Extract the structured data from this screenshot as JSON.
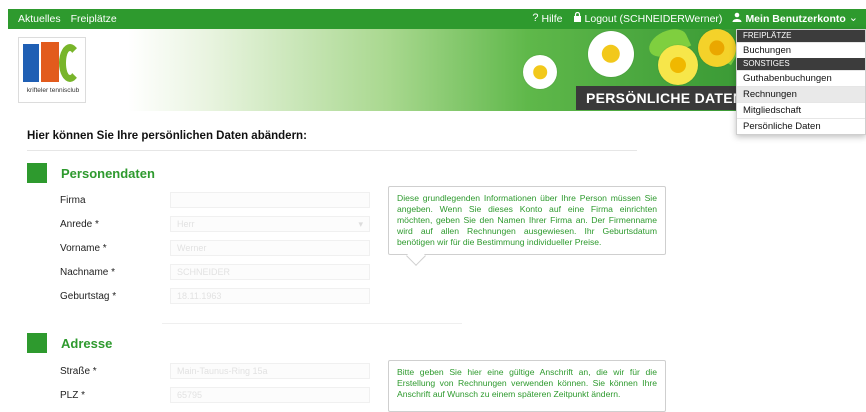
{
  "topbar": {
    "nav_aktuelles": "Aktuelles",
    "nav_freiplaetze": "Freiplätze",
    "help_label": "Hilfe",
    "logout_label": "Logout (SCHNEIDERWerner)",
    "account_label": "Mein Benutzerkonto"
  },
  "logo": {
    "text": "krifteler tennisclub"
  },
  "banner": {
    "title": "PERSÖNLICHE DATEN  SCHN"
  },
  "dropdown": {
    "section1": "FREIPLÄTZE",
    "item_buchungen": "Buchungen",
    "section2": "SONSTIGES",
    "item_guthaben": "Guthabenbuchungen",
    "item_rechnungen": "Rechnungen",
    "item_mitgliedschaft": "Mitgliedschaft",
    "item_persoenlich": "Persönliche Daten"
  },
  "intro": "Hier können Sie Ihre persönlichen Daten abändern:",
  "personendaten": {
    "title": "Personendaten",
    "fields": {
      "firma": {
        "label": "Firma",
        "value": ""
      },
      "anrede": {
        "label": "Anrede *",
        "value": "Herr"
      },
      "vorname": {
        "label": "Vorname *",
        "value": "Werner"
      },
      "nachname": {
        "label": "Nachname *",
        "value": "SCHNEIDER"
      },
      "geburtstag": {
        "label": "Geburtstag *",
        "value": "18.11.1963"
      }
    },
    "note": "Diese grundlegenden Informationen über Ihre Person müssen Sie angeben. Wenn Sie dieses Konto auf eine Firma einrichten möchten, geben Sie den Namen Ihrer Firma an. Der Firmenname wird auf allen Rechnungen ausgewiesen. Ihr Geburtsdatum benötigen wir für die Bestimmung individueller Preise."
  },
  "adresse": {
    "title": "Adresse",
    "fields": {
      "strasse": {
        "label": "Straße *",
        "value": "Main-Taunus-Ring 15a"
      },
      "plz": {
        "label": "PLZ *",
        "value": "65795"
      }
    },
    "note": "Bitte geben Sie hier eine gültige Anschrift an, die wir für die Erstellung von Rechnungen verwenden können. Sie können Ihre Anschrift auf Wunsch zu einem späteren Zeitpunkt ändern."
  },
  "colors": {
    "accent": "#2e9a2e",
    "dark": "#3a3a3a"
  }
}
